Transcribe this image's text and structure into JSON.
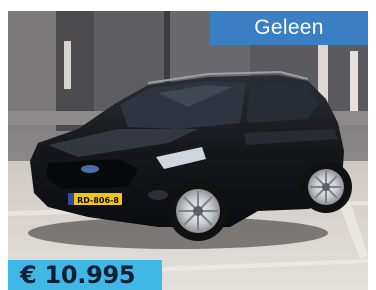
{
  "listing": {
    "location": "Geleen",
    "price": "€ 10.995",
    "plate": "RD-806-8"
  },
  "colors": {
    "location_badge": "#3a7fc3",
    "price_badge": "#3fb8e6",
    "car_body": "#121418"
  }
}
